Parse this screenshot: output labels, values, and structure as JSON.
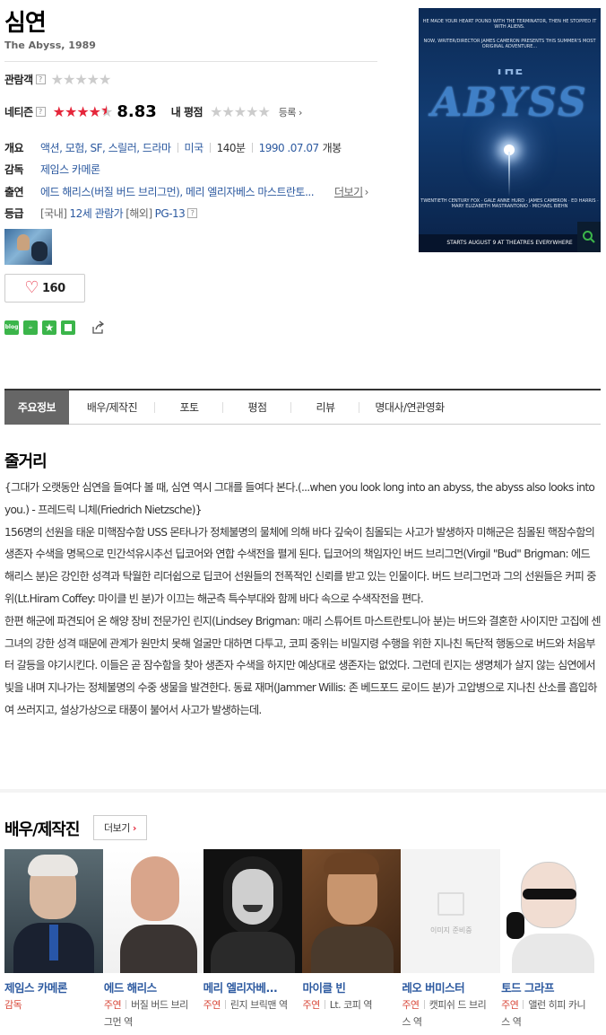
{
  "movie": {
    "title": "심연",
    "subtitle": "The Abyss, 1989"
  },
  "ratings": {
    "audience_label": "관람객",
    "audience_stars": 0,
    "netizen_label": "네티즌",
    "netizen_stars": 8.83,
    "netizen_score": "8.83",
    "my_label": "내 평점",
    "my_stars": 0,
    "register_label": "등록"
  },
  "info": {
    "summary_label": "개요",
    "genres": [
      "액션",
      "모험",
      "SF",
      "스릴러",
      "드라마"
    ],
    "country": "미국",
    "runtime": "140분",
    "release": "1990 .07.07",
    "release_suffix": "개봉",
    "director_label": "감독",
    "director": "제임스 카메론",
    "cast_label": "출연",
    "cast_text": "에드 해리스(버질 버드 브리그먼), 메리 엘리자베스 마스트란토...",
    "cast_more": "더보기",
    "grade_label": "등급",
    "grade_kr_prefix": "[국내]",
    "grade_kr": "12세 관람가",
    "grade_intl_prefix": "[해외]",
    "grade_intl": "PG-13"
  },
  "likes": {
    "count": "160"
  },
  "share": {
    "blog": "blog"
  },
  "poster": {
    "tagline1": "HE MADE YOUR HEART POUND WITH THE TERMINATOR, THEN HE STOPPED IT WITH ALIENS.",
    "tagline2": "NOW, WRITER/DIRECTOR JAMES CAMERON PRESENTS THIS SUMMER'S MOST ORIGINAL ADVENTURE...",
    "name": "THE",
    "title": "ABYSS",
    "credits": "TWENTIETH CENTURY FOX · GALE ANNE HURD · JAMES CAMERON · ED HARRIS · MARY ELIZABETH MASTRANTONIO · MICHAEL BIEHN",
    "bottom": "STARTS AUGUST 9 AT THEATRES EVERYWHERE"
  },
  "tabs": [
    {
      "label": "주요정보",
      "active": true
    },
    {
      "label": "배우/제작진"
    },
    {
      "label": "포토"
    },
    {
      "label": "평점"
    },
    {
      "label": "리뷰"
    },
    {
      "label": "명대사/연관영화"
    }
  ],
  "synopsis": {
    "heading": "줄거리",
    "p1": "{그대가 오랫동안 심연을 들여다 볼 때, 심연 역시 그대를 들여다 본다.(...when you look long into an abyss, the abyss also looks into you.) - 프레드릭 니체(Friedrich Nietzsche)}",
    "p2": "  156명의 선원을 태운 미핵잠수함 USS 몬타나가 정체불명의 물체에 의해 바다 깊숙이 침몰되는 사고가 발생하자 미해군은 침몰된 핵잠수함의 생존자 수색을 명목으로 민간석유시추선 딥코어와 연합 수색전을 펼게 된다. 딥코어의 책임자인 버드 브리그먼(Virgil \"Bud\" Brigman: 에드 해리스 분)은 강인한 성격과 탁월한 리더쉽으로 딥코어 선원들의 전폭적인 신뢰를 받고 있는 인물이다. 버드 브리그먼과 그의 선원들은 커피 중위(Lt.Hiram Coffey: 마이클 빈 분)가 이끄는 해군측 특수부대와 함께 바다 속으로 수색작전을 편다.",
    "p3": "  한편 해군에 파견되어 온 해양 장비 전문가인 린지(Lindsey Brigman: 매리 스튜어트 마스트란토니아 분)는 버드와 결혼한 사이지만 고집에 센 그녀의 강한 성격 때문에 관계가 원만치 못해 얼굴만 대하면 다투고, 코피 중위는 비밀지령 수행을 위한 지나친 독단적 행동으로 버드와 처음부터 갈등을 야기시킨다. 이들은 곧 잠수함을 찾아 생존자 수색을 하지만 예상대로 생존자는 없었다. 그런데 린지는 생명체가 살지 않는 심연에서 빛을 내며 지나가는 정체불명의 수중 생물을 발견한다. 동료 재머(Jammer Willis: 존 베드포드 로이드 분)가 고압병으로 지나친 산소를 흡입하여 쓰러지고, 설상가상으로 태풍이 불어서 사고가 발생하는데."
  },
  "cast_section": {
    "heading": "배우/제작진",
    "more": "더보기",
    "no_image": "이미지 준비중",
    "people": [
      {
        "name": "제임스 카메론",
        "position": "감독",
        "role": ""
      },
      {
        "name": "에드 해리스",
        "position": "주연",
        "role": "버질 버드 브리그먼 역"
      },
      {
        "name": "메리 엘리자베...",
        "position": "주연",
        "role": "린지 브릭맨 역"
      },
      {
        "name": "마이클 빈",
        "position": "주연",
        "role": "Lt. 코피 역"
      },
      {
        "name": "레오 버미스터",
        "position": "주연",
        "role": "캣피쉬 드 브리스 역"
      },
      {
        "name": "토드 그라프",
        "position": "주연",
        "role": "앨런 히피 카니스 역"
      }
    ]
  },
  "colors": {
    "accent": "#e5263a",
    "link": "#2d5aa0",
    "active_tab": "#666666"
  }
}
